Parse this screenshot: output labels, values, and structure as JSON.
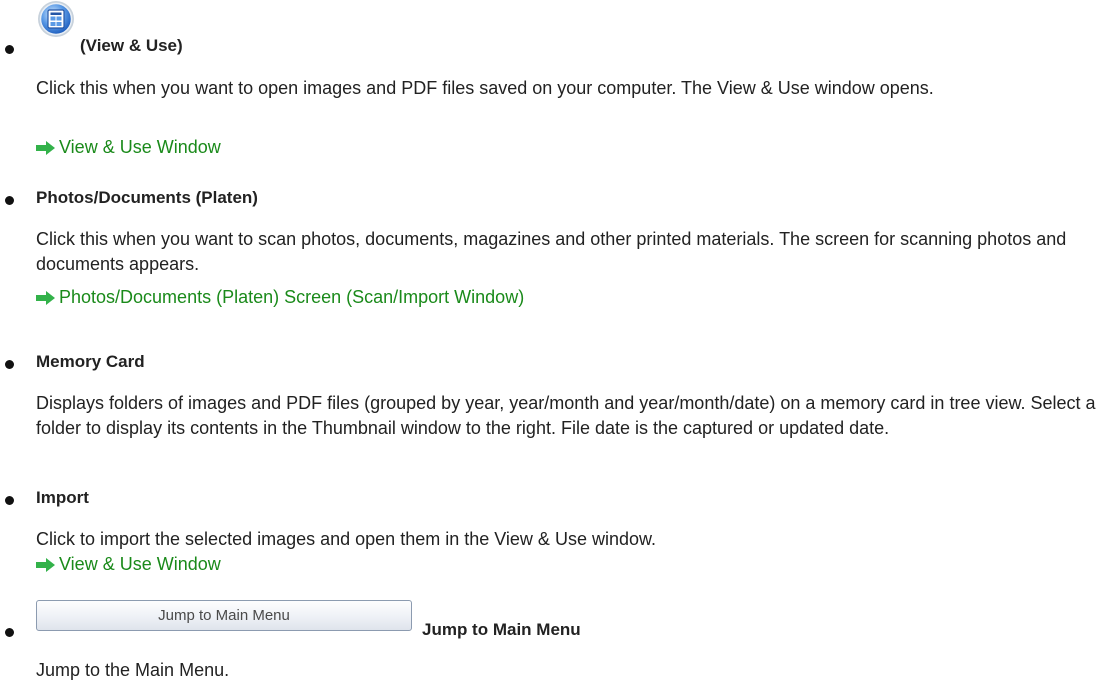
{
  "items": [
    {
      "heading": "(View & Use)",
      "icon": "view-and-use-icon",
      "description": "Click this when you want to open images and PDF files saved on your computer. The View & Use window opens.",
      "link": "View & Use Window"
    },
    {
      "heading": "Photos/Documents (Platen)",
      "description": "Click this when you want to scan photos, documents, magazines and other printed materials. The screen for scanning photos and documents appears.",
      "link": "Photos/Documents (Platen) Screen (Scan/Import Window)"
    },
    {
      "heading": "Memory Card",
      "description": "Displays folders of images and PDF files (grouped by year, year/month and year/month/date) on a memory card in tree view. Select a folder to display its contents in the Thumbnail window to the right. File date is the captured or updated date."
    },
    {
      "heading": "Import",
      "description": "Click to import the selected images and open them in the View & Use window.",
      "link": "View & Use Window"
    },
    {
      "heading": "Jump to Main Menu",
      "button_label": "Jump to Main Menu",
      "description": "Jump to the Main Menu."
    }
  ],
  "colors": {
    "link": "#1a8a1a",
    "link_arrow": "#33b24a",
    "text": "#222222"
  }
}
